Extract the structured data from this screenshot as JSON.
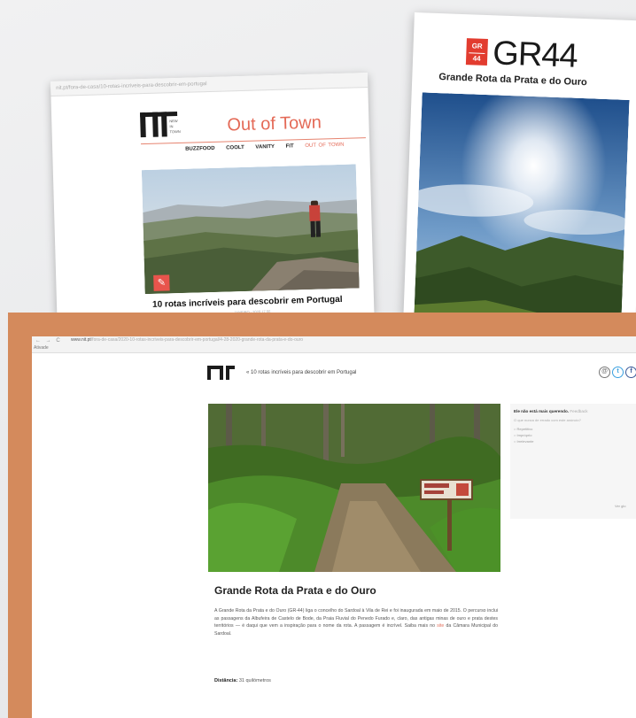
{
  "card1": {
    "url": "nit.pt/fora-de-casa/10-rotas-incriveis-para-descobrir-em-portugal",
    "logo_small_top": "NEW",
    "logo_small_mid": "IN",
    "logo_small_bottom": "TOWN",
    "section_title": "Out of Town",
    "nav": [
      "BUZZFOOD",
      "COOLT",
      "VANITY",
      "FIT",
      "OUT OF TOWN"
    ],
    "headline": "10 rotas incríveis para descobrir em Portugal",
    "meta": "JANEIRO · 2020 17:00",
    "pin_icon": "✎"
  },
  "card2": {
    "badge_top": "GR",
    "badge_bottom": "44",
    "title": "GR44",
    "subtitle": "Grande Rota da Prata e do Ouro"
  },
  "browser": {
    "nav_icons": "← → C",
    "url_domain": "www.nit.pt",
    "url_path": "/fora-de-casa/2020-10-rotas-incriveis-para-descobrir-em-portugal/4-28-2020-grande-rota-da-prata-e-do-ouro",
    "tab": "Ativade"
  },
  "site": {
    "nav_title": "« 10 rotas incríveis para descobrir em Portugal",
    "social": [
      "@",
      "t",
      "f"
    ]
  },
  "article": {
    "title": "Grande Rota da Prata e do Ouro",
    "body_before_link": "A Grande Rota da Prata e do Ouro (GR-44) liga o concelho do Sardoal à Vila de Rei e foi inaugurada em maio de 2015. O percurso inclui as passagens da Albufeira de Castelo de Bode, da Praia Fluvial do Penedo Furado e, claro, das antigas minas de ouro e prata destes territórios — é daqui que vem a inspiração para o nome da rota. A passagem é incrível. Saiba mais no",
    "link": "site",
    "body_after_link": "da Câmara Municipal do Sardoal.",
    "distance_label": "Distância:",
    "distance_value": "31 quilómetros"
  },
  "sidebar": {
    "question": "Ele não está mais querendo.",
    "question_link": "Feedback",
    "prompt": "O que nunca de errado com este anúncio?",
    "options": [
      "Repetitivo",
      "Impróprio",
      "Irrelevante"
    ],
    "more": "Ver glo"
  },
  "colors": {
    "orange_panel": "#d48a5c",
    "nit_red": "#e46a57",
    "gr_red": "#e23c2f"
  }
}
